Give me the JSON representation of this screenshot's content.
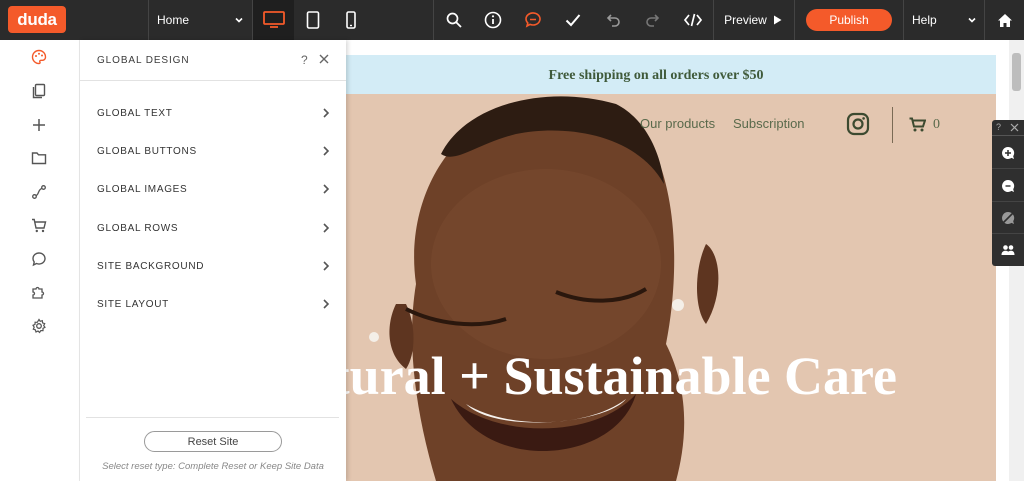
{
  "topbar": {
    "logo": "duda",
    "page_select": "Home",
    "preview_label": "Preview",
    "publish_label": "Publish",
    "help_label": "Help"
  },
  "panel": {
    "title": "GLOBAL DESIGN",
    "help": "?",
    "items": [
      {
        "label": "GLOBAL TEXT"
      },
      {
        "label": "GLOBAL BUTTONS"
      },
      {
        "label": "GLOBAL IMAGES"
      },
      {
        "label": "GLOBAL ROWS"
      },
      {
        "label": "SITE BACKGROUND"
      },
      {
        "label": "SITE LAYOUT"
      }
    ],
    "reset_label": "Reset Site",
    "reset_note": "Select reset type: Complete Reset or Keep Site Data"
  },
  "site": {
    "shipping_banner": "Free shipping on all orders over $50",
    "nav": {
      "products": "Our products",
      "subscription": "Subscription",
      "cart_count": "0"
    },
    "hero_title": "Natural + Sustainable Care"
  },
  "float_tools": {
    "help": "?"
  },
  "colors": {
    "accent": "#f45a2a",
    "topbar": "#2b2b2b",
    "banner": "#d3ecf6",
    "banner_text": "#3f5a3a",
    "hero_bg": "#e3c6b0"
  }
}
